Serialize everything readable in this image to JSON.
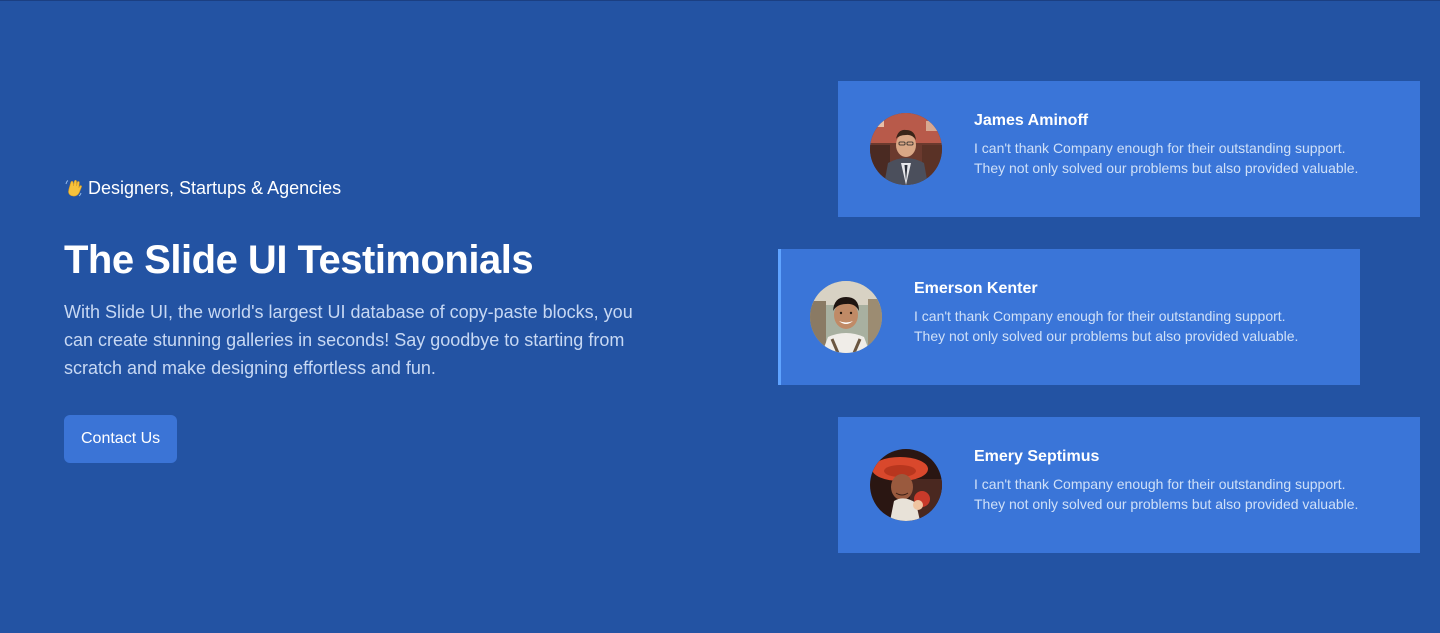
{
  "hero": {
    "eyebrow": "Designers, Startups & Agencies",
    "eyebrow_icon": "waving-hand-icon",
    "title": "The Slide UI Testimonials",
    "description": "With Slide UI, the world's largest UI database of copy-paste blocks, you can create stunning galleries in seconds! Say goodbye to starting from scratch and make designing effortless and fun.",
    "cta_label": "Contact Us"
  },
  "testimonials": [
    {
      "name": "James Aminoff",
      "quote_line1": "I can't thank Company enough for their outstanding support.",
      "quote_line2": "They not only solved our problems but also provided valuable.",
      "active": false
    },
    {
      "name": "Emerson Kenter",
      "quote_line1": "I can't thank Company enough for their outstanding support.",
      "quote_line2": "They not only solved our problems but also provided valuable.",
      "active": true
    },
    {
      "name": "Emery Septimus",
      "quote_line1": "I can't thank Company enough for their outstanding support.",
      "quote_line2": "They not only solved our problems but also provided valuable.",
      "active": false
    }
  ],
  "colors": {
    "background": "#2353a3",
    "card": "#3a75d8",
    "button": "#3b74d6",
    "active_border": "#5fa3ff"
  }
}
